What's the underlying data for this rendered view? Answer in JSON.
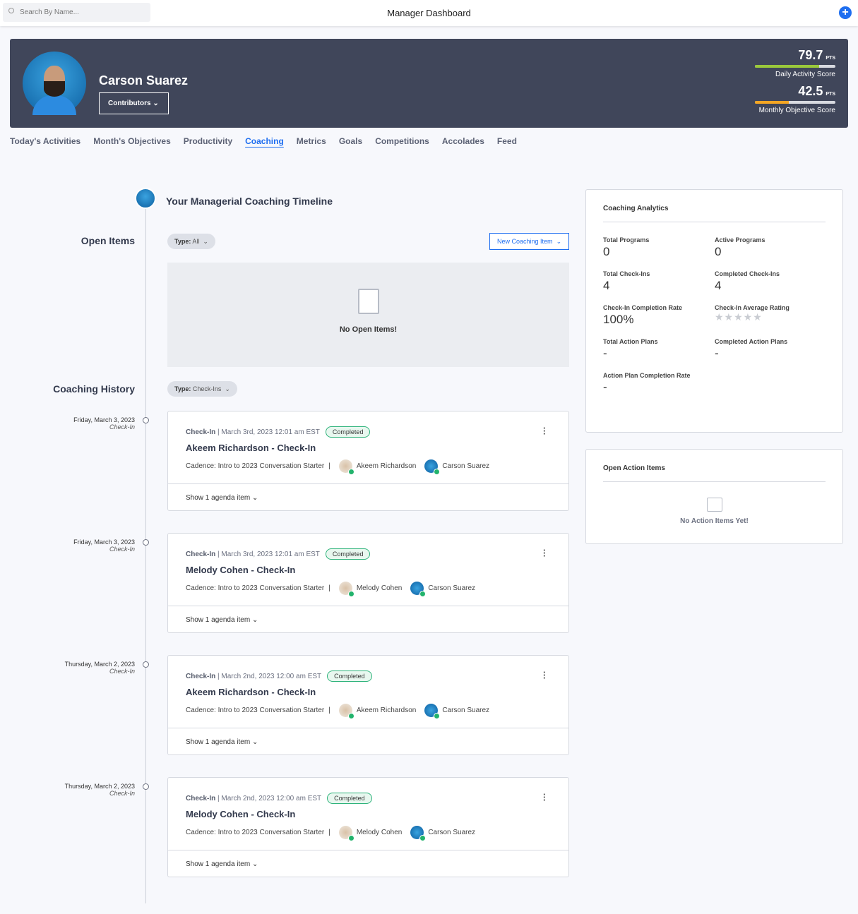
{
  "topbar": {
    "search_placeholder": "Search By Name...",
    "title": "Manager Dashboard",
    "add_icon": "plus-circle-icon"
  },
  "profile": {
    "name": "Carson Suarez",
    "role_button": "Contributors",
    "scores": [
      {
        "value": "79.7",
        "unit": "PTS",
        "label": "Daily Activity Score",
        "fill_pct": 80,
        "color": "#9ac83b"
      },
      {
        "value": "42.5",
        "unit": "PTS",
        "label": "Monthly Objective Score",
        "fill_pct": 42,
        "color": "#f5a623"
      }
    ]
  },
  "tabs": [
    "Today's Activities",
    "Month's Objectives",
    "Productivity",
    "Coaching",
    "Metrics",
    "Goals",
    "Competitions",
    "Accolades",
    "Feed"
  ],
  "active_tab": "Coaching",
  "timeline": {
    "title": "Your Managerial Coaching Timeline",
    "open_items": "Open Items",
    "open_filter_label": "Type:",
    "open_filter_value": "All",
    "new_button": "New Coaching Item",
    "empty_text": "No Open Items!",
    "history": "Coaching History",
    "history_filter_label": "Type:",
    "history_filter_value": "Check-Ins"
  },
  "history": [
    {
      "date": "Friday, March 3, 2023",
      "kind": "Check-In",
      "type": "Check-In",
      "timestamp": "March 3rd, 2023 12:01 am EST",
      "status": "Completed",
      "title": "Akeem Richardson - Check-In",
      "cadence": "Cadence: Intro to 2023 Conversation Starter",
      "participants": [
        "Akeem Richardson",
        "Carson Suarez"
      ],
      "agenda": "Show 1 agenda item"
    },
    {
      "date": "Friday, March 3, 2023",
      "kind": "Check-In",
      "type": "Check-In",
      "timestamp": "March 3rd, 2023 12:01 am EST",
      "status": "Completed",
      "title": "Melody Cohen - Check-In",
      "cadence": "Cadence: Intro to 2023 Conversation Starter",
      "participants": [
        "Melody Cohen",
        "Carson Suarez"
      ],
      "agenda": "Show 1 agenda item"
    },
    {
      "date": "Thursday, March 2, 2023",
      "kind": "Check-In",
      "type": "Check-In",
      "timestamp": "March 2nd, 2023 12:00 am EST",
      "status": "Completed",
      "title": "Akeem Richardson - Check-In",
      "cadence": "Cadence: Intro to 2023 Conversation Starter",
      "participants": [
        "Akeem Richardson",
        "Carson Suarez"
      ],
      "agenda": "Show 1 agenda item"
    },
    {
      "date": "Thursday, March 2, 2023",
      "kind": "Check-In",
      "type": "Check-In",
      "timestamp": "March 2nd, 2023 12:00 am EST",
      "status": "Completed",
      "title": "Melody Cohen - Check-In",
      "cadence": "Cadence: Intro to 2023 Conversation Starter",
      "participants": [
        "Melody Cohen",
        "Carson Suarez"
      ],
      "agenda": "Show 1 agenda item"
    }
  ],
  "analytics": {
    "title": "Coaching Analytics",
    "stats": [
      {
        "label": "Total Programs",
        "value": "0"
      },
      {
        "label": "Active Programs",
        "value": "0"
      },
      {
        "label": "Total Check-Ins",
        "value": "4"
      },
      {
        "label": "Completed Check-Ins",
        "value": "4"
      },
      {
        "label": "Check-In Completion Rate",
        "value": "100%"
      },
      {
        "label": "Check-In Average Rating",
        "value": "",
        "rating": 0,
        "max_rating": 5
      },
      {
        "label": "Total Action Plans",
        "value": "-"
      },
      {
        "label": "Completed Action Plans",
        "value": "-"
      },
      {
        "label": "Action Plan Completion Rate",
        "value": "-"
      }
    ]
  },
  "action_items": {
    "title": "Open Action Items",
    "empty_text": "No Action Items Yet!"
  }
}
